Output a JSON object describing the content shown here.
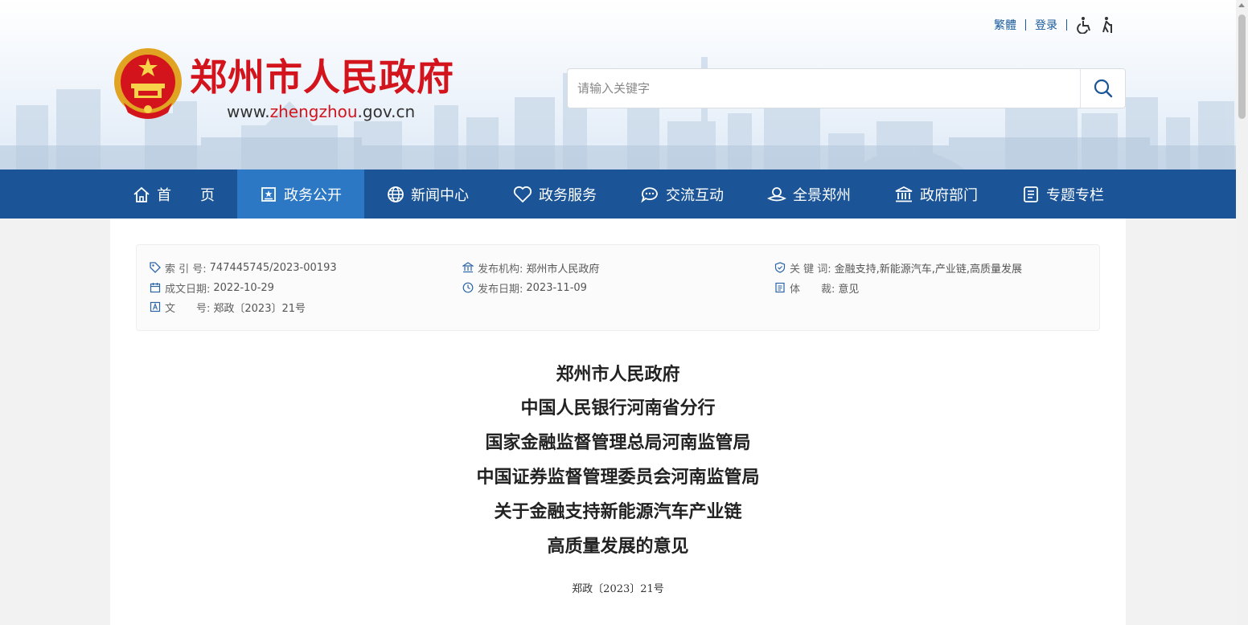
{
  "header": {
    "site_title": "郑州市人民政府",
    "url_prefix": "www.",
    "url_highlight": "zhengzhou",
    "url_suffix": ".gov.cn",
    "top_links": {
      "traditional": "繁體",
      "login": "登录"
    },
    "search": {
      "placeholder": "请输入关键字",
      "value": ""
    }
  },
  "nav": {
    "items": [
      {
        "label": "首　　页",
        "icon": "home-icon"
      },
      {
        "label": "政务公开",
        "icon": "gov-affairs-icon",
        "active": true
      },
      {
        "label": "新闻中心",
        "icon": "globe-icon"
      },
      {
        "label": "政务服务",
        "icon": "heart-icon"
      },
      {
        "label": "交流互动",
        "icon": "chat-icon"
      },
      {
        "label": "全景郑州",
        "icon": "panorama-icon"
      },
      {
        "label": "政府部门",
        "icon": "building-icon"
      },
      {
        "label": "专题专栏",
        "icon": "topic-icon"
      }
    ]
  },
  "meta": {
    "index_no": {
      "label": "索 引 号:",
      "value": "747445745/2023-00193"
    },
    "publisher": {
      "label": "发布机构:",
      "value": "郑州市人民政府"
    },
    "keywords": {
      "label": "关 键 词:",
      "value": "金融支持,新能源汽车,产业链,高质量发展"
    },
    "created_date": {
      "label": "成文日期:",
      "value": "2022-10-29"
    },
    "publish_date": {
      "label": "发布日期:",
      "value": "2023-11-09"
    },
    "genre": {
      "label": "体　　裁:",
      "value": "意见"
    },
    "doc_number": {
      "label": "文　　号:",
      "value": "郑政〔2023〕21号"
    }
  },
  "document": {
    "title_lines": [
      "郑州市人民政府",
      "中国人民银行河南省分行",
      "国家金融监督管理总局河南监管局",
      "中国证券监督管理委员会河南监管局",
      "关于金融支持新能源汽车产业链",
      "高质量发展的意见"
    ],
    "doc_no": "郑政〔2023〕21号"
  },
  "colors": {
    "brand_red": "#d3141c",
    "nav_blue": "#1b5597",
    "nav_active": "#2c78c4",
    "link_blue": "#1a5a9c"
  }
}
